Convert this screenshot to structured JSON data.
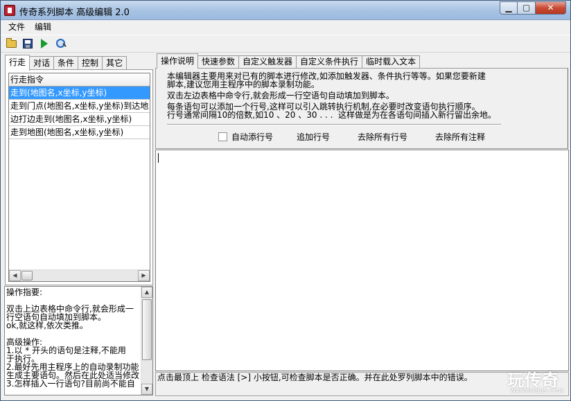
{
  "window": {
    "title": "传奇系列脚本 高级编辑 2.0",
    "min": "▁",
    "max": "▢",
    "close": "✕"
  },
  "menu": [
    "文件",
    "编辑"
  ],
  "toolbar": {
    "icons": [
      "open-folder-icon",
      "save-disk-icon",
      "run-play-icon",
      "check-syntax-icon"
    ]
  },
  "left_tabs": [
    "行走",
    "对话",
    "条件",
    "控制",
    "其它"
  ],
  "command_grid": {
    "header": "行走指令",
    "rows": [
      "走到(地图名,x坐标,y坐标)",
      "走到门点(地图名,x坐标,y坐标)到达地",
      "边打边走到(地图名,x坐标,y坐标)",
      "走到地图(地图名,x坐标,y坐标)"
    ]
  },
  "left_info": "操作指要:\n\n双击上边表格中命令行,就会形成一\n行空语句自动填加到脚本。\nok,就这样,依次类推。\n\n高级操作:\n1.以 * 开头的语句是注释,不能用\n于执行。\n2.最好先用主程序上的自动录制功能\n生成主要语句。然后在此处适当修改\n3.怎样插入一行语句?目前尚不能自",
  "right_tabs": [
    "操作说明",
    "快速参数",
    "自定义触发器",
    "自定义条件执行",
    "临时载入文本"
  ],
  "description": {
    "p1": "本编辑器主要用来对已有的脚本进行修改,如添加触发器、条件执行等等。如果您要新建\n脚本,建议您用主程序中的脚本录制功能。",
    "p2": "双击左边表格中命令行,就会形成一行空语句自动填加到脚本。",
    "p3": "每条语句可以添加一个行号,这样可以引入跳转执行机制,在必要时改变语句执行顺序。\n行号通常间隔10的倍数,如10 、20 、30 . . .  这样做是为在各语句间插入新行留出余地。"
  },
  "options": {
    "auto_line_label": "自动添行号",
    "add_line": "追加行号",
    "remove_lines": "去除所有行号",
    "remove_comments": "去除所有注释"
  },
  "editor": {
    "content": ""
  },
  "status": "点击最顶上 检查语法 [>] 小按钮,可检查脚本是否正确。并在此处罗列脚本中的错误。",
  "watermark": {
    "logo": "玩传奇",
    "url": "WANMIRBBS.COM"
  }
}
